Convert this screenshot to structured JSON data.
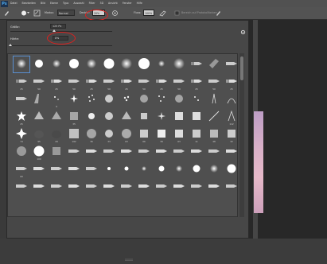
{
  "app": {
    "logo": "Ps"
  },
  "menu": [
    "Datei",
    "Bearbeiten",
    "Bild",
    "Ebene",
    "Typo",
    "Auswahl",
    "Filter",
    "3D",
    "Ansicht",
    "Fenster",
    "Hilfe"
  ],
  "options_bar": {
    "mode_label": "Modus:",
    "mode_value": "Normal",
    "opacity_label": "Deckkr.:",
    "opacity_value": "20%",
    "flow_label": "Fluss:",
    "flow_value": "100%",
    "extra_label": "Bereich auf Protokollfarben"
  },
  "brush_panel": {
    "size_label": "Größe:",
    "size_value": "125 Px",
    "hardness_label": "Härte:",
    "hardness_value": "0%"
  },
  "accent": "#e0201e",
  "brushes": {
    "row1": [
      "",
      "",
      "",
      "",
      "",
      "",
      "",
      "",
      "",
      "",
      "",
      "",
      "",
      ""
    ],
    "row2": [
      "25",
      "50",
      "25",
      "50",
      "25",
      "50",
      "25",
      "50",
      "25",
      "50",
      "25",
      "50",
      "25",
      "50"
    ],
    "row3": [
      "",
      "",
      "9",
      "",
      "",
      "",
      "",
      "",
      "",
      "",
      "",
      "",
      "",
      ""
    ],
    "row4": [
      "25",
      "",
      "",
      "35",
      "",
      "",
      "",
      "",
      "",
      "",
      "",
      "",
      "112",
      "134"
    ],
    "row5": [
      "74",
      "95",
      "29",
      "192",
      "36",
      "33",
      "63",
      "66",
      "39",
      "63",
      "11",
      "48",
      "32",
      "55"
    ],
    "row6": [
      "",
      "100",
      "",
      "",
      "",
      "",
      "",
      "",
      "",
      "",
      "",
      "",
      "",
      ""
    ],
    "row7": [
      "60",
      "",
      "",
      "",
      "",
      "",
      "",
      "",
      "",
      "",
      "",
      "",
      "",
      ""
    ],
    "row8": [
      "",
      "",
      "",
      "",
      "",
      "",
      "",
      "",
      "",
      "",
      "",
      "",
      "",
      ""
    ]
  }
}
